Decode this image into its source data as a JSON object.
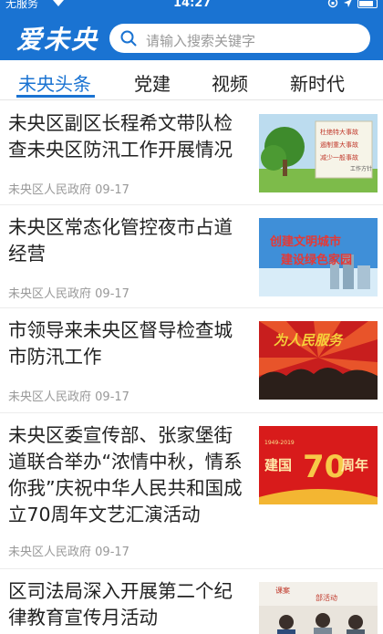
{
  "status": {
    "carrier": "无服务",
    "time": "14:27"
  },
  "header": {
    "logo": "爱未央",
    "search_placeholder": "请输入搜索关键字"
  },
  "tabs": [
    {
      "label": "未央头条"
    },
    {
      "label": "党建"
    },
    {
      "label": "视频"
    },
    {
      "label": "新时代"
    }
  ],
  "news": [
    {
      "title": "未央区副区长程希文带队检查未央区防汛工作开展情况",
      "source": "未央区人民政府",
      "date": "09-17",
      "thumb_text": [
        "杜绝特大事故",
        "遏制重大事故",
        "减少一般事故",
        "工作方针"
      ]
    },
    {
      "title": "未央区常态化管控夜市占道经营",
      "source": "未央区人民政府",
      "date": "09-17",
      "thumb_text": [
        "创建文明城市",
        "建设绿色家园"
      ]
    },
    {
      "title": "市领导来未央区督导检查城市防汛工作",
      "source": "未央区人民政府",
      "date": "09-17",
      "thumb_text": [
        "为人民服务"
      ]
    },
    {
      "title": "未央区委宣传部、张家堡街道联合举办“浓情中秋，情系你我”庆祝中华人民共和国成立70周年文艺汇演活动",
      "source": "未央区人民政府",
      "date": "09-17",
      "thumb_text": [
        "建国",
        "70",
        "周年",
        "1949-2019"
      ]
    },
    {
      "title": "区司法局深入开展第二个纪律教育宣传月活动",
      "source": "",
      "date": "",
      "thumb_text": [
        "课案",
        "部活动"
      ]
    }
  ]
}
